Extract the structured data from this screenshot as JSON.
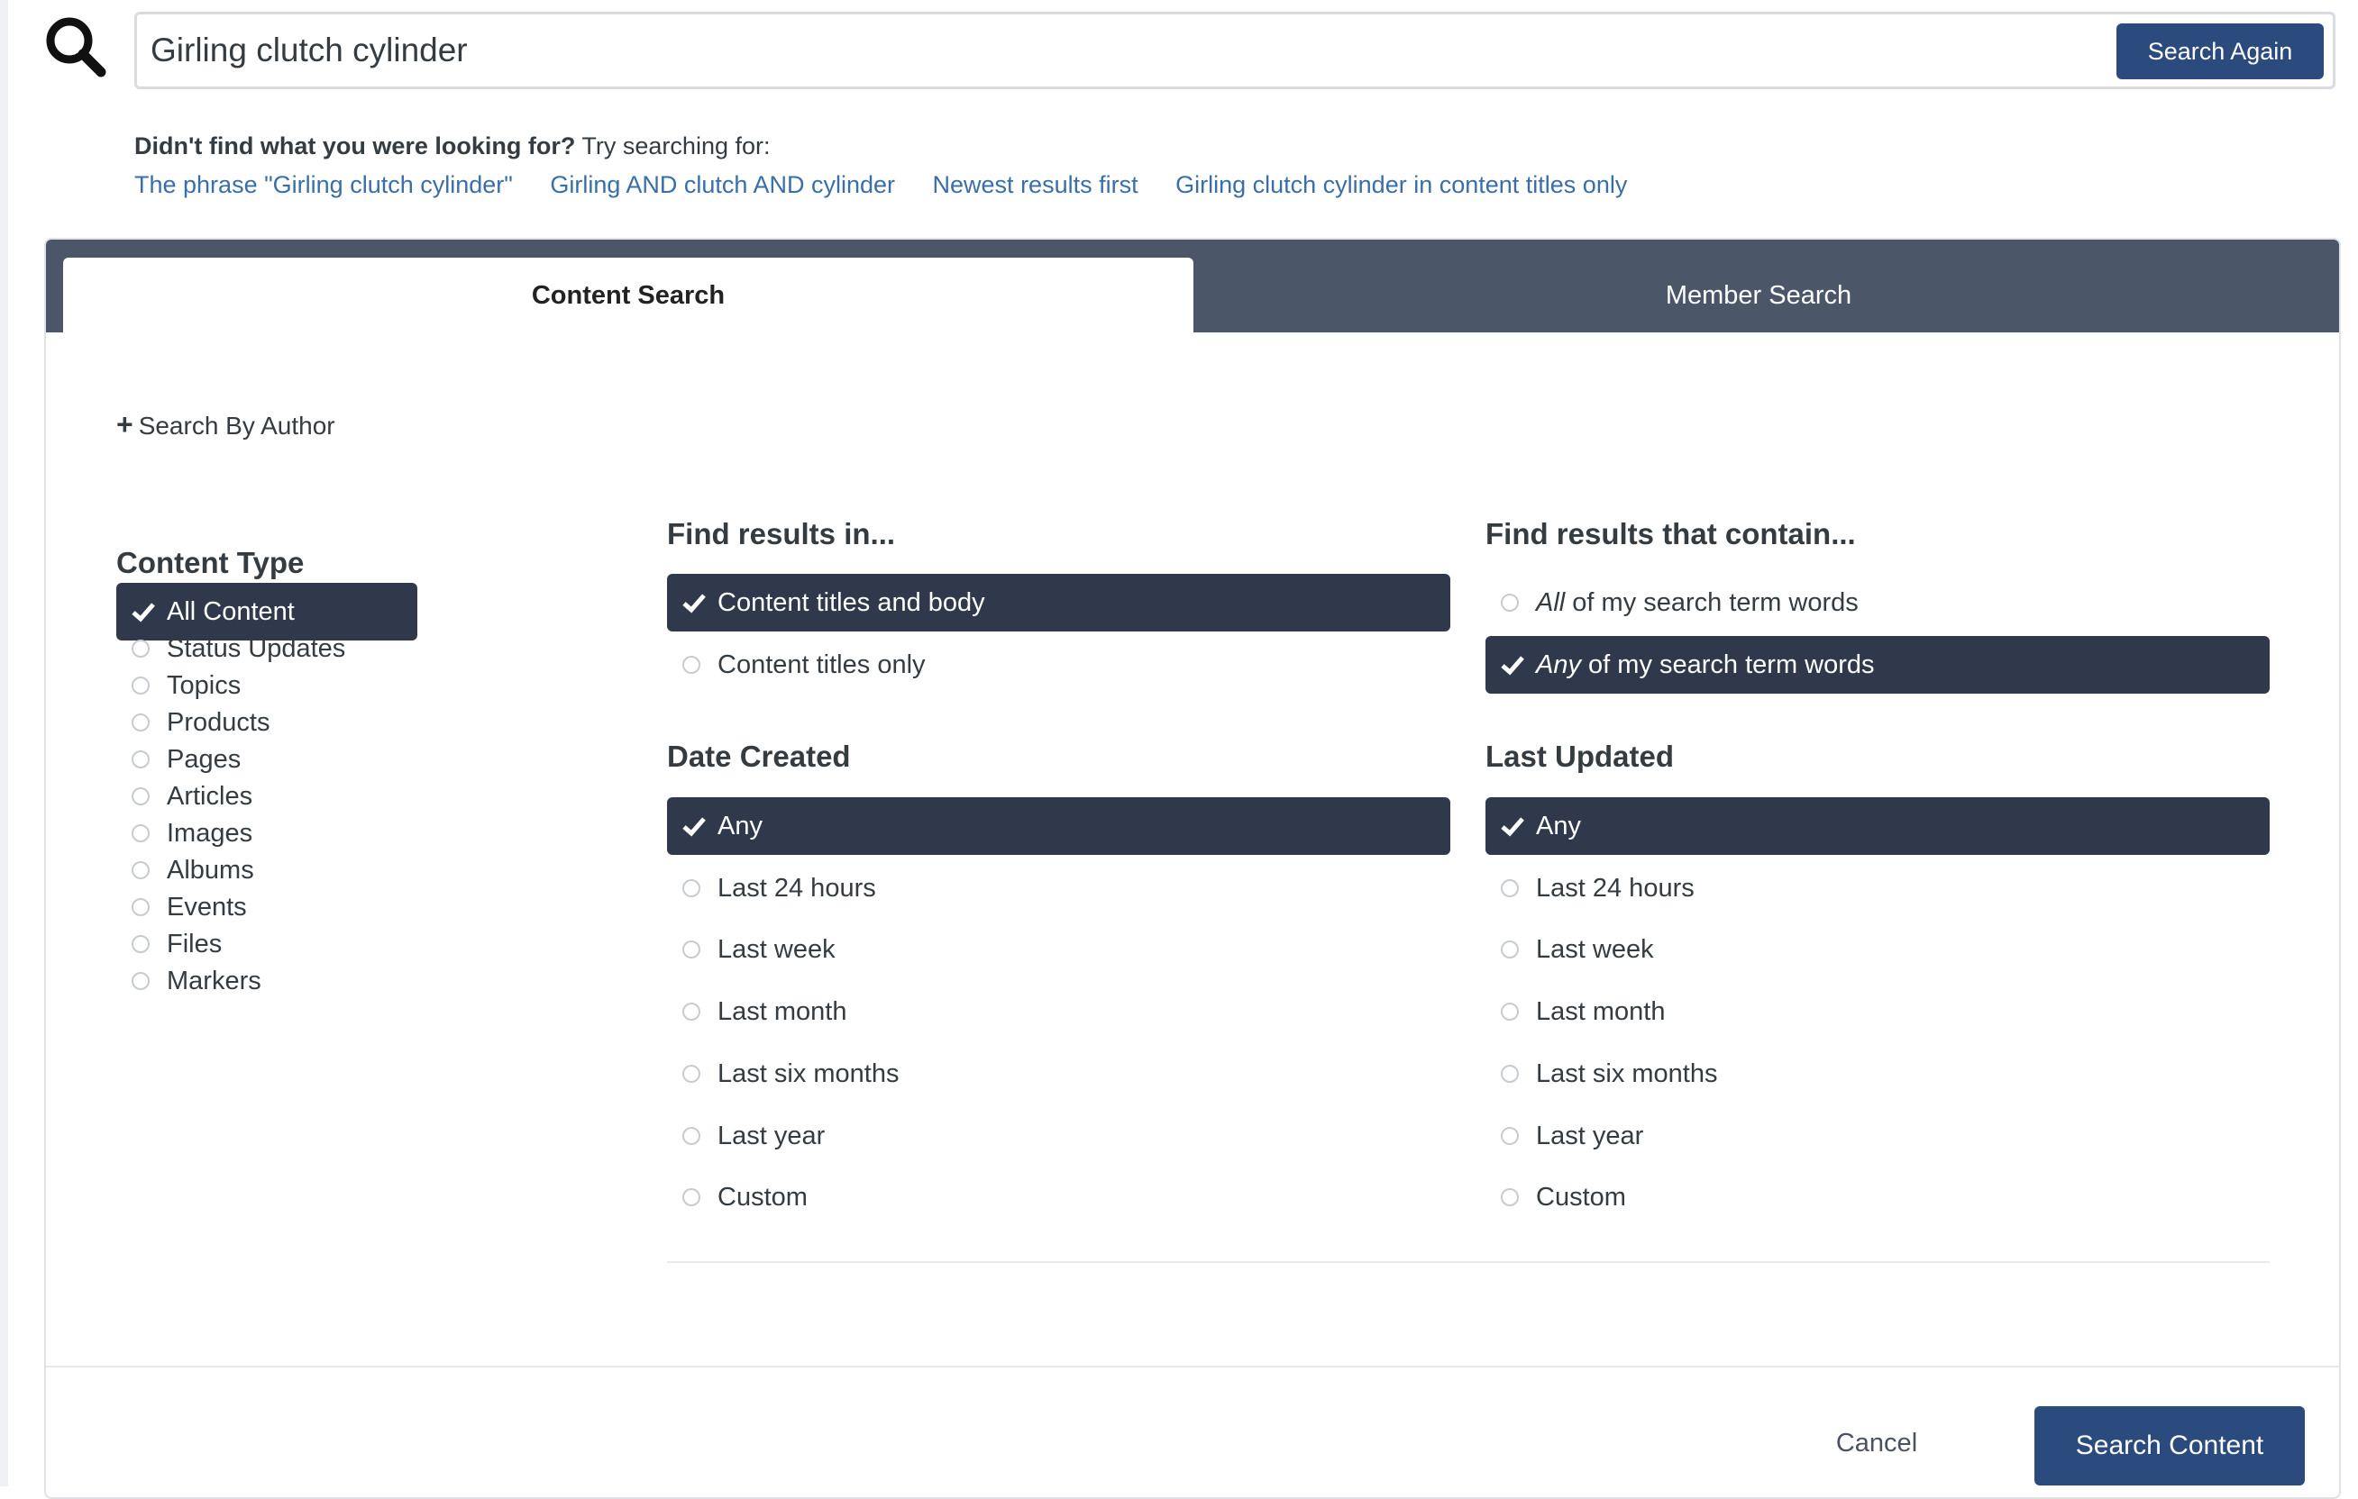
{
  "search": {
    "query": "Girling clutch cylinder",
    "button_label": "Search Again"
  },
  "suggestions": {
    "heading_bold": "Didn't find what you were looking for?",
    "heading_rest": " Try searching for:",
    "links": [
      "The phrase \"Girling clutch cylinder\"",
      "Girling AND clutch AND cylinder",
      "Newest results first",
      "Girling clutch cylinder in content titles only"
    ]
  },
  "tabs": {
    "content": "Content Search",
    "member": "Member Search"
  },
  "search_by_author": {
    "icon": "plus-icon",
    "label": "Search By Author"
  },
  "content_type": {
    "heading": "Content Type",
    "options": [
      "All Content",
      "Status Updates",
      "Topics",
      "Products",
      "Pages",
      "Articles",
      "Images",
      "Albums",
      "Events",
      "Files",
      "Markers"
    ],
    "selected": "All Content"
  },
  "find_in": {
    "heading": "Find results in...",
    "options": [
      "Content titles and body",
      "Content titles only"
    ],
    "selected": "Content titles and body"
  },
  "contain": {
    "heading": "Find results that contain...",
    "options": [
      {
        "em": "All",
        "rest": " of my search term words"
      },
      {
        "em": "Any",
        "rest": " of my search term words"
      }
    ],
    "selected": "Any"
  },
  "date_created": {
    "heading": "Date Created",
    "options": [
      "Any",
      "Last 24 hours",
      "Last week",
      "Last month",
      "Last six months",
      "Last year",
      "Custom"
    ],
    "selected": "Any"
  },
  "last_updated": {
    "heading": "Last Updated",
    "options": [
      "Any",
      "Last 24 hours",
      "Last week",
      "Last month",
      "Last six months",
      "Last year",
      "Custom"
    ],
    "selected": "Any"
  },
  "footer": {
    "cancel_label": "Cancel",
    "submit_label": "Search Content"
  },
  "colors": {
    "accent": "#2b4a7d",
    "selected_bg": "#2f394b",
    "tabbar_bg": "#4b5669",
    "link": "#3a6ea8"
  }
}
